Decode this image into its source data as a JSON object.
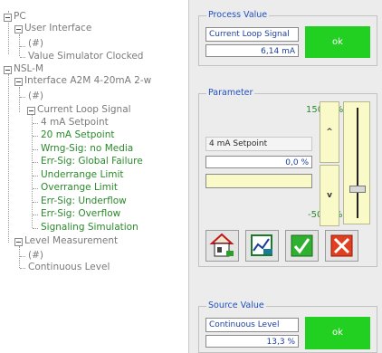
{
  "tree": {
    "pc": "PC",
    "user_interface": "User Interface",
    "ui_hash": "(#)",
    "value_sim": "Value Simulator Clocked",
    "nsl": "NSL-M",
    "interface": "Interface A2M 4-20mA 2-w",
    "if_hash": "(#)",
    "current_loop": "Current Loop Signal",
    "items": [
      "4 mA Setpoint",
      "20 mA Setpoint",
      "Wrng-Sig: no Media",
      "Err-Sig: Global Failure",
      "Underrange Limit",
      "Overrange Limit",
      "Err-Sig: Underflow",
      "Err-Sig: Overflow",
      "Signaling Simulation"
    ],
    "level_measurement": "Level Measurement",
    "lm_hash": "(#)",
    "continuous_level": "Continuous Level"
  },
  "process": {
    "title": "Process Value",
    "name": "Current Loop Signal",
    "value": "6,14 mA",
    "status": "ok"
  },
  "parameter": {
    "title": "Parameter",
    "max": "150,0 %",
    "name": "4 mA Setpoint",
    "value": "0,0 %",
    "min": "-50,0 %",
    "up": "^",
    "down": "v",
    "slider_fraction": 0.25
  },
  "source": {
    "title": "Source Value",
    "name": "Continuous Level",
    "value": "13,3 %",
    "status": "ok"
  },
  "colors": {
    "ok_green": "#22d022",
    "tree_green": "#2b8a2b",
    "title_blue": "#2050c0"
  },
  "icons": [
    "home-building-icon",
    "chart-edit-icon",
    "checkmark-icon",
    "cancel-x-icon"
  ]
}
